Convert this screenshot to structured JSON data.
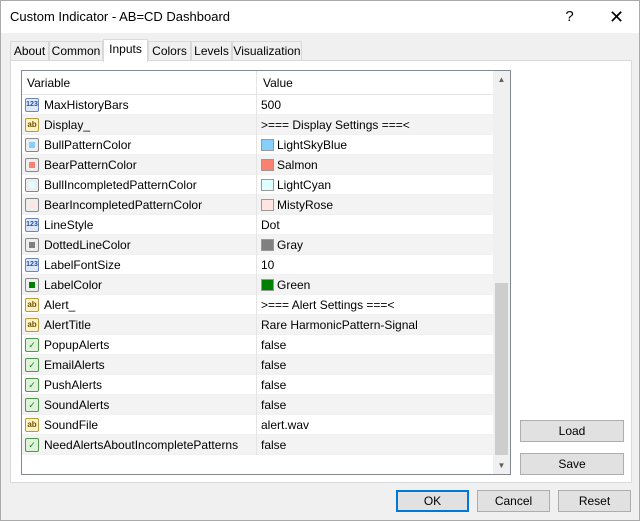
{
  "window": {
    "title": "Custom Indicator - AB=CD Dashboard",
    "help_glyph": "?",
    "close_glyph": "✕"
  },
  "tabs": [
    {
      "label": "About",
      "active": false
    },
    {
      "label": "Common",
      "active": false
    },
    {
      "label": "Inputs",
      "active": true
    },
    {
      "label": "Colors",
      "active": false
    },
    {
      "label": "Levels",
      "active": false
    },
    {
      "label": "Visualization",
      "active": false
    }
  ],
  "grid": {
    "headers": {
      "variable": "Variable",
      "value": "Value"
    },
    "rows": [
      {
        "type": "num",
        "icon": "integer-icon",
        "variable": "MaxHistoryBars",
        "value": "500"
      },
      {
        "type": "str",
        "icon": "string-icon",
        "variable": "Display_",
        "value": ">=== Display Settings ===<"
      },
      {
        "type": "color",
        "icon": "color-icon",
        "variable": "BullPatternColor",
        "value": "LightSkyBlue",
        "swatch": "#87cefa"
      },
      {
        "type": "color",
        "icon": "color-icon",
        "variable": "BearPatternColor",
        "value": "Salmon",
        "swatch": "#fa8072"
      },
      {
        "type": "color",
        "icon": "color-icon",
        "variable": "BullIncompletedPatternColor",
        "value": "LightCyan",
        "swatch": "#e0ffff"
      },
      {
        "type": "color",
        "icon": "color-icon",
        "variable": "BearIncompletedPatternColor",
        "value": "MistyRose",
        "swatch": "#ffe4e1"
      },
      {
        "type": "num",
        "icon": "integer-icon",
        "variable": "LineStyle",
        "value": "Dot"
      },
      {
        "type": "color",
        "icon": "color-icon",
        "variable": "DottedLineColor",
        "value": "Gray",
        "swatch": "#808080"
      },
      {
        "type": "num",
        "icon": "integer-icon",
        "variable": "LabelFontSize",
        "value": "10"
      },
      {
        "type": "color",
        "icon": "color-icon",
        "variable": "LabelColor",
        "value": "Green",
        "swatch": "#008000"
      },
      {
        "type": "str",
        "icon": "string-icon",
        "variable": "Alert_",
        "value": ">=== Alert Settings ===<"
      },
      {
        "type": "str",
        "icon": "string-icon",
        "variable": "AlertTitle",
        "value": "Rare HarmonicPattern-Signal"
      },
      {
        "type": "bool",
        "icon": "boolean-icon",
        "variable": "PopupAlerts",
        "value": "false"
      },
      {
        "type": "bool",
        "icon": "boolean-icon",
        "variable": "EmailAlerts",
        "value": "false"
      },
      {
        "type": "bool",
        "icon": "boolean-icon",
        "variable": "PushAlerts",
        "value": "false"
      },
      {
        "type": "bool",
        "icon": "boolean-icon",
        "variable": "SoundAlerts",
        "value": "false"
      },
      {
        "type": "str",
        "icon": "string-icon",
        "variable": "SoundFile",
        "value": "alert.wav"
      },
      {
        "type": "bool",
        "icon": "boolean-icon",
        "variable": "NeedAlertsAboutIncompletePatterns",
        "value": "false"
      }
    ]
  },
  "icon_glyphs": {
    "num": "123",
    "str": "ab",
    "bool": "✓"
  },
  "scrollbar": {
    "up_glyph": "▲",
    "down_glyph": "▼"
  },
  "side_buttons": {
    "load": "Load",
    "save": "Save"
  },
  "footer": {
    "ok": "OK",
    "cancel": "Cancel",
    "reset": "Reset"
  },
  "colors": {
    "accent": "#0078d7"
  }
}
